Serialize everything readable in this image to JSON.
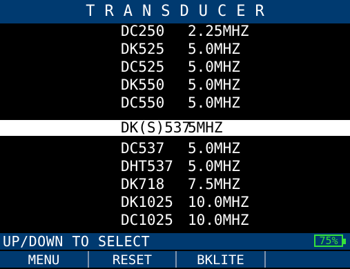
{
  "title": "TRANSDUCER",
  "transducers": [
    {
      "model": "DC250",
      "freq": "2.25MHZ",
      "selected": false
    },
    {
      "model": "DK525",
      "freq": "5.0MHZ",
      "selected": false
    },
    {
      "model": "DC525",
      "freq": "5.0MHZ",
      "selected": false
    },
    {
      "model": "DK550",
      "freq": "5.0MHZ",
      "selected": false
    },
    {
      "model": "DC550",
      "freq": "5.0MHZ",
      "selected": false
    },
    {
      "model": "DK(S)537",
      "freq": "5MHZ",
      "selected": true
    },
    {
      "model": "DC537",
      "freq": "5.0MHZ",
      "selected": false
    },
    {
      "model": "DHT537",
      "freq": "5.0MHZ",
      "selected": false
    },
    {
      "model": "DK718",
      "freq": "7.5MHZ",
      "selected": false
    },
    {
      "model": "DK1025",
      "freq": "10.0MHZ",
      "selected": false
    },
    {
      "model": "DC1025",
      "freq": "10.0MHZ",
      "selected": false
    }
  ],
  "status": {
    "hint": "UP/DOWN TO SELECT",
    "battery": "75%",
    "battery_level": 0.75
  },
  "softkeys": {
    "key1": "MENU",
    "key2": "RESET",
    "key3": "BKLITE",
    "key4": ""
  },
  "colors": {
    "bar_background": "#003a70",
    "battery": "#35e23a",
    "highlight": "#ffffff"
  }
}
